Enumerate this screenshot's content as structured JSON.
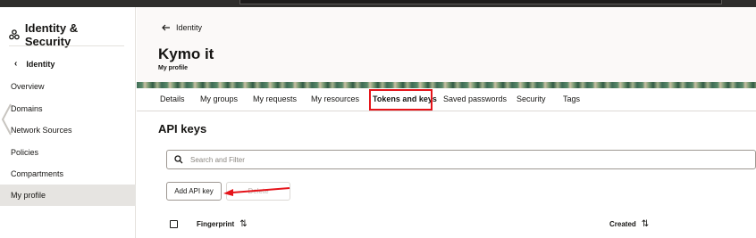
{
  "sidebar": {
    "title": "Identity & Security",
    "back_label": "Identity",
    "items": [
      {
        "label": "Overview",
        "active": false
      },
      {
        "label": "Domains",
        "active": false
      },
      {
        "label": "Network Sources",
        "active": false
      },
      {
        "label": "Policies",
        "active": false
      },
      {
        "label": "Compartments",
        "active": false
      },
      {
        "label": "My profile",
        "active": true
      }
    ]
  },
  "header": {
    "breadcrumb": "Identity",
    "title": "Kymo it",
    "subtitle": "My profile"
  },
  "tabs": [
    {
      "label": "Details"
    },
    {
      "label": "My groups"
    },
    {
      "label": "My requests"
    },
    {
      "label": "My resources"
    },
    {
      "label": "Tokens and keys",
      "active": true
    },
    {
      "label": "Saved passwords"
    },
    {
      "label": "Security"
    },
    {
      "label": "Tags"
    }
  ],
  "main": {
    "section_title": "API keys",
    "search_placeholder": "Search and Filter",
    "add_button": "Add API key",
    "delete_button": "Delete",
    "columns": {
      "fingerprint": "Fingerprint",
      "created": "Created"
    }
  },
  "colors": {
    "highlight": "#e5141a",
    "active_nav_bg": "#e6e4e1"
  }
}
